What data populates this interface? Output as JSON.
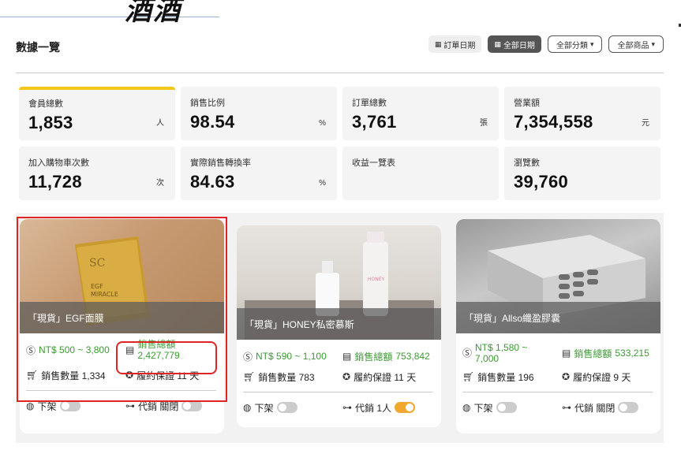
{
  "logo": {
    "text": "酒酒"
  },
  "page_title": "數據一覽",
  "toolbar": {
    "order_date": "訂單日期",
    "all_dates": "全部日期",
    "all_categories": "全部分類",
    "all_products": "全部商品"
  },
  "stats": [
    {
      "label": "會員總數",
      "value": "1,853",
      "unit": "人"
    },
    {
      "label": "銷售比例",
      "value": "98.54",
      "unit": "%"
    },
    {
      "label": "訂單總數",
      "value": "3,761",
      "unit": "張"
    },
    {
      "label": "營業額",
      "value": "7,354,558",
      "unit": "元"
    },
    {
      "label": "加入購物車次數",
      "value": "11,728",
      "unit": "次"
    },
    {
      "label": "實際銷售轉換率",
      "value": "84.63",
      "unit": "%"
    },
    {
      "label": "收益一覽表",
      "value": "",
      "unit": ""
    },
    {
      "label": "瀏覽數",
      "value": "39,760",
      "unit": ""
    }
  ],
  "cards": [
    {
      "name": "「現貨」EGF面膜",
      "price": "NT$ 500 ~ 3,800",
      "sales_label": "銷售總額",
      "sales_value": "2,427,779",
      "qty": "銷售數量 1,334",
      "warranty": "履約保證 11 天",
      "shelf": "下架",
      "agent": "代銷 關閉"
    },
    {
      "name": "「現貨」HONEY私密慕斯",
      "price": "NT$ 590 ~ 1,100",
      "sales_label": "銷售總額",
      "sales_value": "753,842",
      "qty": "銷售數量 783",
      "warranty": "履約保證 11 天",
      "shelf": "下架",
      "agent": "代銷 1人"
    },
    {
      "name": "「現貨」Allso纖盈膠囊",
      "price": "NT$ 1,580 ~ 7,000",
      "sales_label": "銷售總額",
      "sales_value": "533,215",
      "qty": "銷售數量 196",
      "warranty": "履約保證 9 天",
      "shelf": "下架",
      "agent": "代銷 關閉"
    }
  ],
  "product_image_text": {
    "card1": [
      "SC",
      "EGF",
      "MIRACLE"
    ],
    "card2": "HONEY"
  },
  "colors": {
    "accent_yellow": "#f5c518",
    "green": "#3d9a34",
    "highlight_red": "#e02424",
    "toggle_on": "#f0a830"
  }
}
